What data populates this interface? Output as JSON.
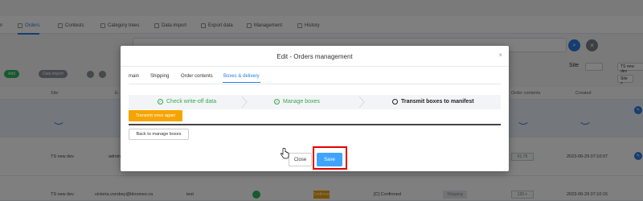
{
  "nav": {
    "items": [
      {
        "label": "m"
      },
      {
        "label": "Orders"
      },
      {
        "label": "Contests"
      },
      {
        "label": "Category trees"
      },
      {
        "label": "Data import"
      },
      {
        "label": "Export data"
      },
      {
        "label": "Management"
      },
      {
        "label": "History"
      }
    ]
  },
  "toolbar": {
    "add_label": "Add",
    "import_label": "Data import",
    "site_label": "Site",
    "site_value": "TS new dev",
    "site_small": "Site ×"
  },
  "table": {
    "headers": [
      "Site",
      "E-",
      "Order contents",
      "Created"
    ],
    "rows": [
      {
        "site": "TS new dev",
        "email": "admin",
        "amount": "61.75",
        "created": "2023-06-29 07:10:07"
      },
      {
        "site": "TS new dev",
        "email": "victoria.vorobey@bloomex.ca",
        "status_text": "test",
        "tag": "Confirmed",
        "order_id": "[C] Confirmed",
        "shipping": "Shipping",
        "amount": "120.+",
        "created": "2023-06-29 07:10:15"
      }
    ]
  },
  "modal": {
    "title": "Edit - Orders management",
    "close_glyph": "×",
    "tabs": [
      "main",
      "Shipping",
      "Order contents",
      "Boxes & delivery"
    ],
    "active_tab": 3,
    "steps": [
      {
        "label": "Check write-off data",
        "state": "done"
      },
      {
        "label": "Manage boxes",
        "state": "done"
      },
      {
        "label": "Transmit boxes to manifest",
        "state": "current"
      }
    ],
    "transmit_label": "Transmit once again",
    "back_label": "Back to manage boxes",
    "close_label": "Close",
    "save_label": "Save"
  },
  "colors": {
    "accent": "#2b7de0",
    "save": "#3fa4ff",
    "transmit": "#f6a400",
    "step_done": "#3aa84f",
    "highlight": "#e30000"
  }
}
